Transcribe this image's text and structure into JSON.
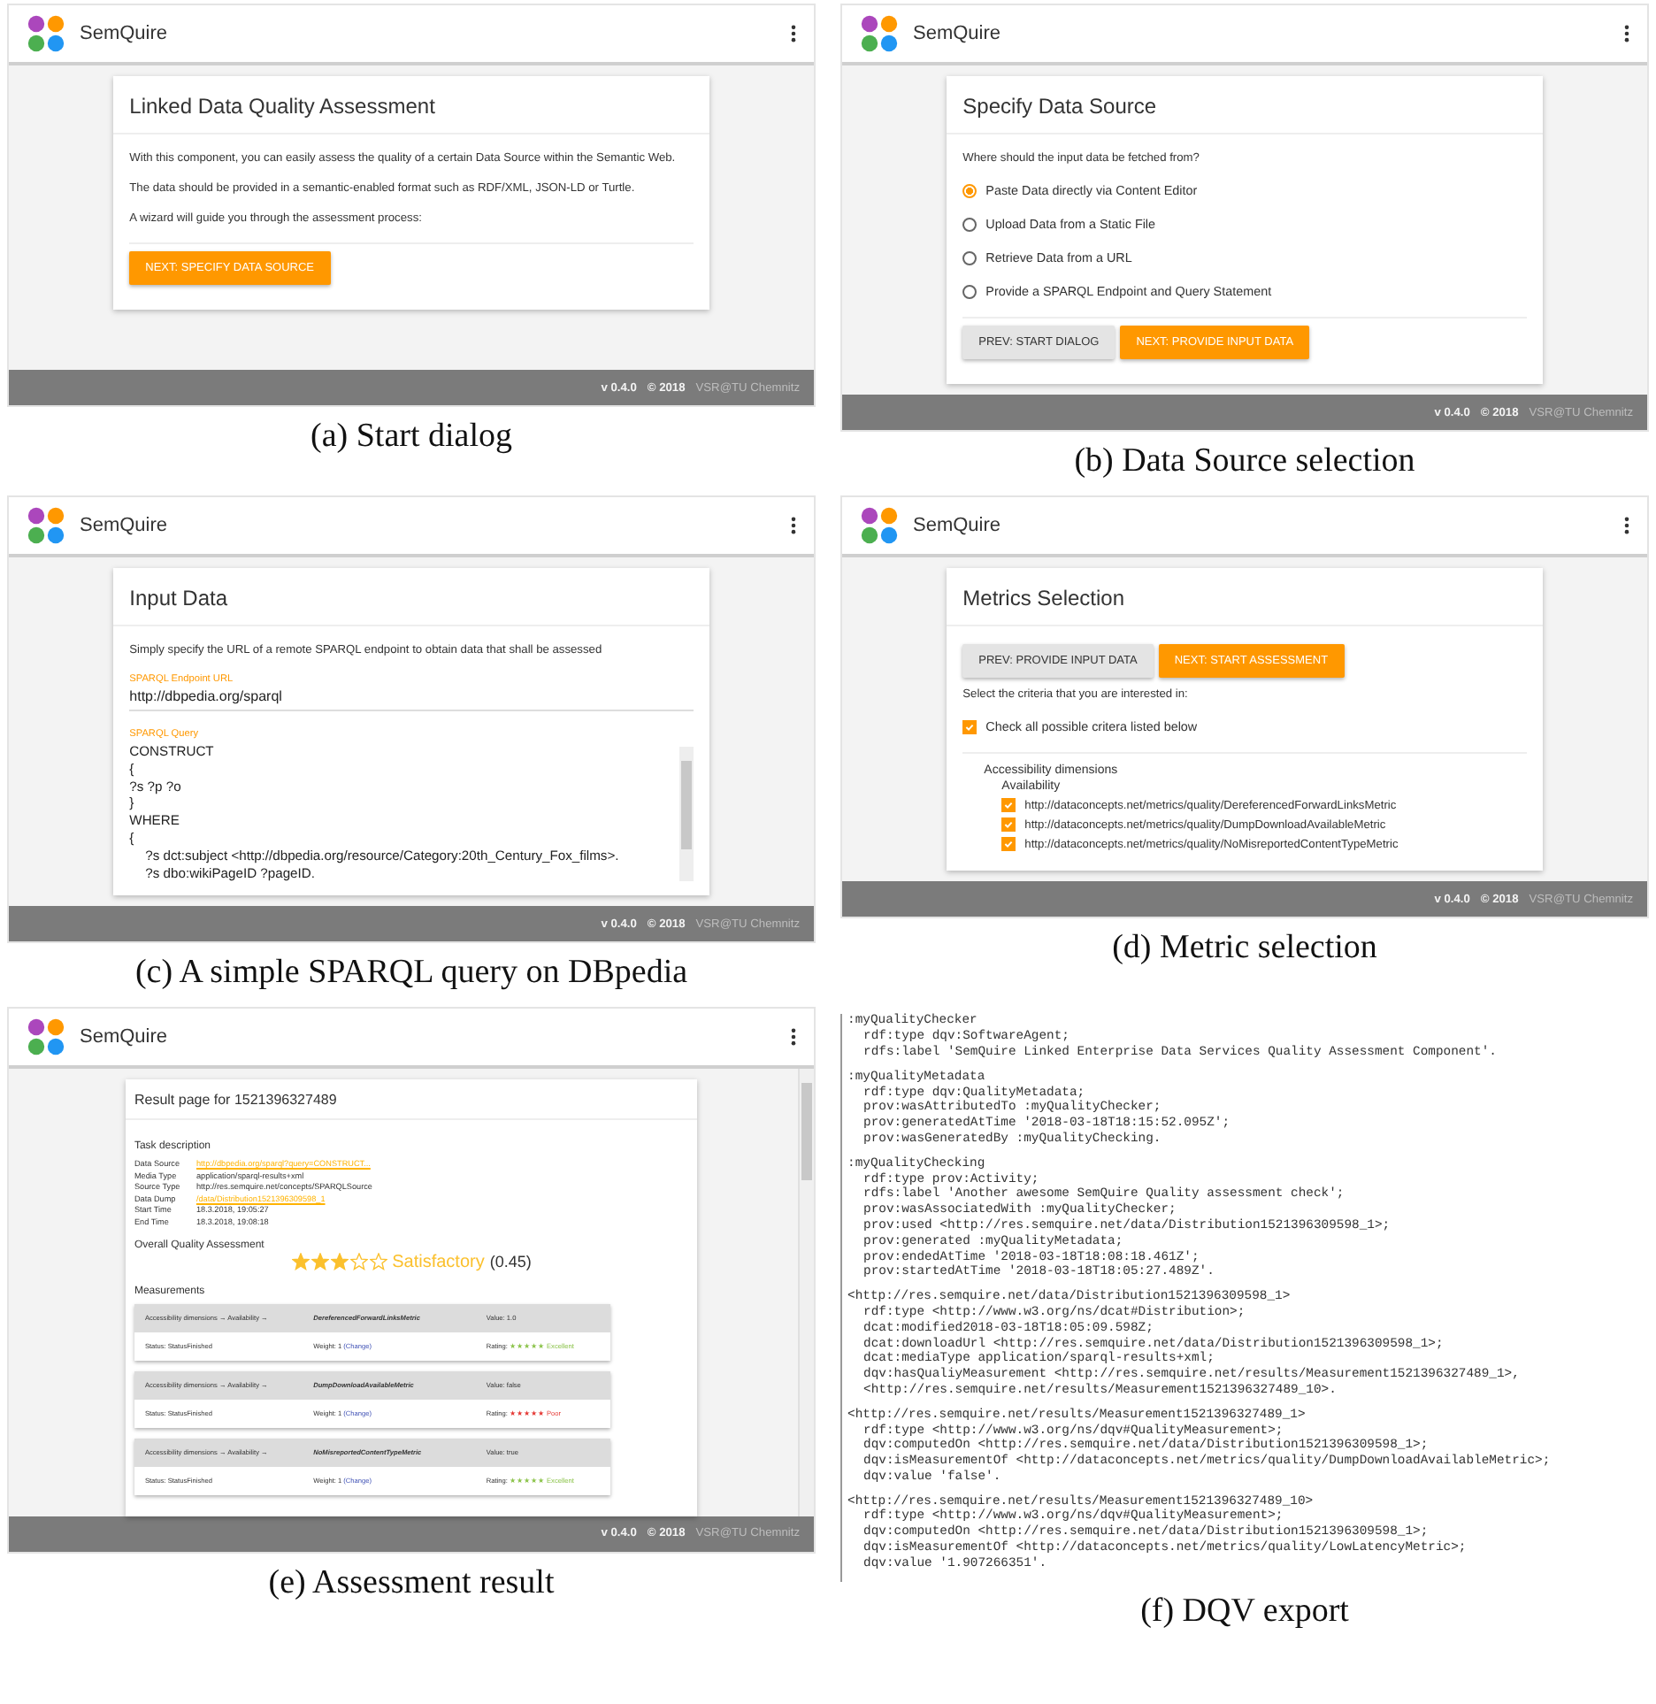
{
  "panels": [
    {
      "kind": "start",
      "caption": "(a) Start dialog",
      "brand": "SemQuire",
      "footer": {
        "version": "v 0.4.0",
        "copyright": "© 2018",
        "credit": "VSR@TU Chemnitz"
      },
      "title": "Linked Data Quality Assessment",
      "paragraphs": [
        "With this component, you can easily assess the quality of a certain Data Source within the Semantic Web.",
        "The data should be provided in a semantic-enabled format such as RDF/XML, JSON-LD or Turtle.",
        "A wizard will guide you through the assessment process:"
      ],
      "buttons": [
        {
          "label": "NEXT: SPECIFY DATA SOURCE",
          "kind": "primary"
        }
      ]
    },
    {
      "kind": "source",
      "caption": "(b) Data Source selection",
      "brand": "SemQuire",
      "footer": {
        "version": "v 0.4.0",
        "copyright": "© 2018",
        "credit": "VSR@TU Chemnitz"
      },
      "title": "Specify Data Source",
      "question": "Where should the input data be fetched from?",
      "options": [
        {
          "label": "Paste Data directly via Content Editor",
          "selected": true
        },
        {
          "label": "Upload Data from a Static File",
          "selected": false
        },
        {
          "label": "Retrieve Data from a URL",
          "selected": false
        },
        {
          "label": "Provide a SPARQL Endpoint and Query Statement",
          "selected": false
        }
      ],
      "buttons": [
        {
          "label": "PREV: START DIALOG",
          "kind": "secondary"
        },
        {
          "label": "NEXT: PROVIDE INPUT DATA",
          "kind": "primary"
        }
      ]
    },
    {
      "kind": "input",
      "caption": "(c) A simple SPARQL query on DBpedia",
      "brand": "SemQuire",
      "footer": {
        "version": "v 0.4.0",
        "copyright": "© 2018",
        "credit": "VSR@TU Chemnitz"
      },
      "title": "Input Data",
      "intro": "Simply specify the URL of a remote SPARQL endpoint to obtain data that shall be assessed",
      "endpoint": {
        "label": "SPARQL Endpoint URL",
        "value": "http://dbpedia.org/sparql"
      },
      "query": {
        "label": "SPARQL Query",
        "lines": [
          "CONSTRUCT",
          "{",
          "?s ?p ?o",
          "}",
          "WHERE",
          "{"
        ],
        "body_lines": [
          "?s dct:subject <http://dbpedia.org/resource/Category:20th_Century_Fox_films>.",
          "?s dbo:wikiPageID ?pageID."
        ]
      }
    },
    {
      "kind": "metrics",
      "caption": "(d) Metric selection",
      "brand": "SemQuire",
      "footer": {
        "version": "v 0.4.0",
        "copyright": "© 2018",
        "credit": "VSR@TU Chemnitz"
      },
      "title": "Metrics Selection",
      "buttons": [
        {
          "label": "PREV: PROVIDE INPUT DATA",
          "kind": "secondary"
        },
        {
          "label": "NEXT: START ASSESSMENT",
          "kind": "primary"
        }
      ],
      "prompt": "Select the criteria that you are interested in:",
      "check_all": {
        "label": "Check all possible critera listed below",
        "checked": true
      },
      "group": "Accessibility dimensions",
      "subgroup": "Availability",
      "metrics": [
        {
          "label": "http://dataconcepts.net/metrics/quality/DereferencedForwardLinksMetric",
          "checked": true
        },
        {
          "label": "http://dataconcepts.net/metrics/quality/DumpDownloadAvailableMetric",
          "checked": true
        },
        {
          "label": "http://dataconcepts.net/metrics/quality/NoMisreportedContentTypeMetric",
          "checked": true
        }
      ]
    },
    {
      "kind": "result",
      "caption": "(e) Assessment result",
      "brand": "SemQuire",
      "footer": {
        "version": "v 0.4.0",
        "copyright": "© 2018",
        "credit": "VSR@TU Chemnitz"
      },
      "title": "Result page for 1521396327489",
      "task_heading": "Task description",
      "task": [
        {
          "label": "Data Source",
          "value": "http://dbpedia.org/sparql?query=CONSTRUCT...",
          "link": true
        },
        {
          "label": "Media Type",
          "value": "application/sparql-results+xml",
          "link": false
        },
        {
          "label": "Source Type",
          "value": "http://res.semquire.net/concepts/SPARQLSource",
          "link": false
        },
        {
          "label": "Data Dump",
          "value": "/data/Distribution1521396309598_1",
          "link": true
        },
        {
          "label": "Start Time",
          "value": "18.3.2018, 19:05:27",
          "link": false
        },
        {
          "label": "End Time",
          "value": "18.3.2018, 19:08:18",
          "link": false
        }
      ],
      "overall_heading": "Overall Quality Assessment",
      "stars": 3,
      "rating": "Satisfactory",
      "score": "(0.45)",
      "measurements_heading": "Measurements",
      "measurements": [
        {
          "path": "Accessibility dimensions → Availability →",
          "metric": "DereferencedForwardLinksMetric",
          "value": "Value: 1.0",
          "status": "Status: StatusFinished",
          "weight": "Weight: 1",
          "change": "(Change)",
          "rating_label": "Rating:",
          "rating": "★★★★★ Excellent",
          "color": "#8bc34a"
        },
        {
          "path": "Accessibility dimensions → Availability →",
          "metric": "DumpDownloadAvailableMetric",
          "value": "Value: false",
          "status": "Status: StatusFinished",
          "weight": "Weight: 1",
          "change": "(Change)",
          "rating_label": "Rating:",
          "rating": "★★★★★ Poor",
          "color": "#e53935"
        },
        {
          "path": "Accessibility dimensions → Availability →",
          "metric": "NoMisreportedContentTypeMetric",
          "value": "Value: true",
          "status": "Status: StatusFinished",
          "weight": "Weight: 1",
          "change": "(Change)",
          "rating_label": "Rating:",
          "rating": "★★★★★ Excellent",
          "color": "#8bc34a"
        }
      ]
    },
    {
      "kind": "export",
      "caption": "(f) DQV export",
      "blocks": [
        [
          ":myQualityChecker",
          "rdf:type dqv:SoftwareAgent;",
          "rdfs:label 'SemQuire Linked Enterprise Data Services Quality Assessment Component'."
        ],
        [
          ":myQualityMetadata",
          "rdf:type dqv:QualityMetadata;",
          "prov:wasAttributedTo :myQualityChecker;",
          "prov:generatedAtTime '2018-03-18T18:15:52.095Z';",
          "prov:wasGeneratedBy :myQualityChecking."
        ],
        [
          ":myQualityChecking",
          "rdf:type prov:Activity;",
          "rdfs:label 'Another awesome SemQuire Quality assessment check';",
          "prov:wasAssociatedWith :myQualityChecker;",
          "prov:used <http://res.semquire.net/data/Distribution1521396309598_1>;",
          "prov:generated :myQualityMetadata;",
          "prov:endedAtTime '2018-03-18T18:08:18.461Z';",
          "prov:startedAtTime '2018-03-18T18:05:27.489Z'."
        ],
        [
          "<http://res.semquire.net/data/Distribution1521396309598_1>",
          "rdf:type <http://www.w3.org/ns/dcat#Distribution>;",
          "dcat:modified2018-03-18T18:05:09.598Z;",
          "dcat:downloadUrl <http://res.semquire.net/data/Distribution1521396309598_1>;",
          "dcat:mediaType application/sparql-results+xml;",
          "dqv:hasQualiyMeasurement <http://res.semquire.net/results/Measurement1521396327489_1>,",
          "<http://res.semquire.net/results/Measurement1521396327489_10>."
        ],
        [
          "<http://res.semquire.net/results/Measurement1521396327489_1>",
          "rdf:type <http://www.w3.org/ns/dqv#QualityMeasurement>;",
          "dqv:computedOn <http://res.semquire.net/data/Distribution1521396309598_1>;",
          "dqv:isMeasurementOf <http://dataconcepts.net/metrics/quality/DumpDownloadAvailableMetric>;",
          "dqv:value 'false'."
        ],
        [
          "<http://res.semquire.net/results/Measurement1521396327489_10>",
          "rdf:type <http://www.w3.org/ns/dqv#QualityMeasurement>;",
          "dqv:computedOn <http://res.semquire.net/data/Distribution1521396309598_1>;",
          "dqv:isMeasurementOf <http://dataconcepts.net/metrics/quality/LowLatencyMetric>;",
          "dqv:value '1.907266351'."
        ]
      ]
    }
  ]
}
